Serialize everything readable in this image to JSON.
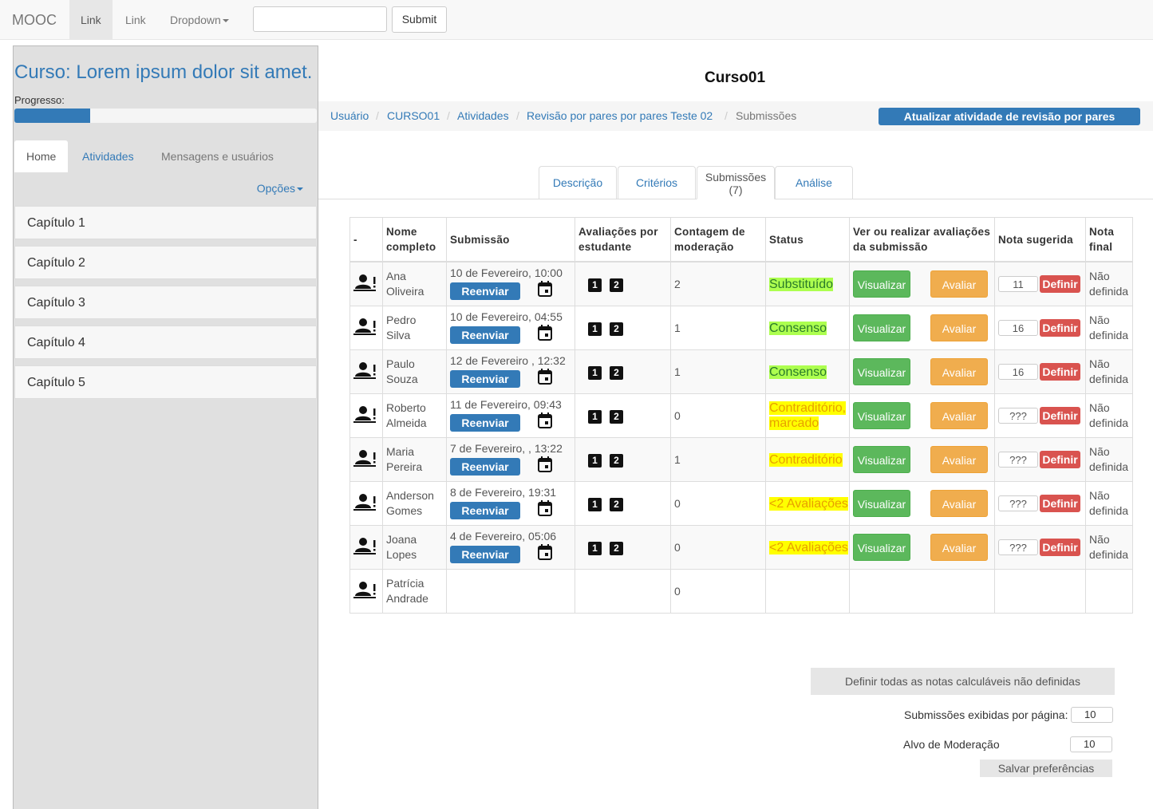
{
  "navbar": {
    "brand": "MOOC",
    "links": [
      "Link",
      "Link"
    ],
    "dropdown": "Dropdown",
    "search_value": "",
    "submit": "Submit"
  },
  "sidebar": {
    "course_title": "Curso: Lorem ipsum dolor sit amet.",
    "progress_label": "Progresso:",
    "progress_fraction": 0.25,
    "tabs": [
      "Home",
      "Atividades",
      "Mensagens e usuários"
    ],
    "options": "Opções",
    "chapters": [
      "Capítulo 1",
      "Capítulo 2",
      "Capítulo 3",
      "Capítulo 4",
      "Capítulo 5"
    ]
  },
  "main": {
    "title": "Curso01",
    "breadcrumb": [
      "Usuário",
      "CURSO01",
      "Atividades",
      "Revisão por pares por pares Teste 02",
      "Submissões"
    ],
    "update_button": "Atualizar atividade de revisão por pares",
    "tabs": [
      "Descrição",
      "Critérios",
      "Submissões",
      "(7)",
      "Análise"
    ]
  },
  "table": {
    "headers": [
      "-",
      "Nome completo",
      "Submissão",
      "Avaliações por estudante",
      "Contagem de moderação",
      "Status",
      "Ver ou realizar avaliações da submissão",
      "Nota sugerida",
      "Nota final"
    ],
    "resend": "Reenviar",
    "view": "Visualizar",
    "evaluate": "Avaliar",
    "define": "Definir",
    "rows": [
      {
        "first": "Ana",
        "last": "Oliveira",
        "date": "10 de Fevereiro, 10:00",
        "count": "2",
        "status": "Substituído",
        "status_kind": "green",
        "grade": "11",
        "final1": "Não",
        "final2": "definida"
      },
      {
        "first": "Pedro",
        "last": "Silva",
        "date": "10 de Fevereiro, 04:55",
        "count": "1",
        "status": "Consenso",
        "status_kind": "green",
        "grade": "16",
        "final1": "Não",
        "final2": "definida"
      },
      {
        "first": "Paulo",
        "last": "Souza",
        "date": "12 de Fevereiro , 12:32",
        "count": "1",
        "status": "Consenso",
        "status_kind": "green",
        "grade": "16",
        "final1": "Não",
        "final2": "definida"
      },
      {
        "first": "Roberto",
        "last": "Almeida",
        "date": "11 de Fevereiro, 09:43",
        "count": "0",
        "status": "Contraditório, marcado",
        "status_kind": "yellow",
        "grade": "???",
        "final1": "Não",
        "final2": "definida"
      },
      {
        "first": "Maria",
        "last": "Pereira",
        "date": "7 de Fevereiro, , 13:22",
        "count": "1",
        "status": "Contraditório",
        "status_kind": "yellow",
        "grade": "???",
        "final1": "Não",
        "final2": "definida"
      },
      {
        "first": "Anderson",
        "last": "Gomes",
        "date": "8 de Fevereiro, 19:31",
        "count": "0",
        "status": "<2 Avaliações",
        "status_kind": "yellow",
        "grade": "???",
        "final1": "Não",
        "final2": "definida"
      },
      {
        "first": "Joana",
        "last": "Lopes",
        "date": "4 de Fevereiro, 05:06",
        "count": "0",
        "status": "<2 Avaliações",
        "status_kind": "yellow",
        "grade": "???",
        "final1": "Não",
        "final2": "definida"
      },
      {
        "first": "Patrícia",
        "last": "Andrade",
        "date": "",
        "count": "0",
        "status": "",
        "status_kind": "none",
        "grade": "",
        "final1": "",
        "final2": ""
      }
    ]
  },
  "controls": {
    "set_all": "Definir todas as notas calculáveis não definidas",
    "per_page_label": "Submissões exibidas por página:",
    "per_page_value": "10",
    "moderation_label": "Alvo de Moderação",
    "moderation_value": "10",
    "save": "Salvar preferências"
  }
}
